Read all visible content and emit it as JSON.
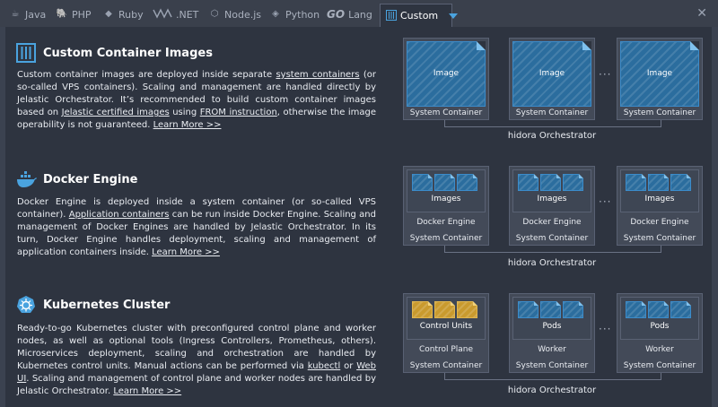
{
  "tabs": [
    {
      "label": "Java",
      "icon": "java-icon"
    },
    {
      "label": "PHP",
      "icon": "php-icon"
    },
    {
      "label": "Ruby",
      "icon": "ruby-icon"
    },
    {
      "label": ".NET",
      "icon": "dotnet-icon"
    },
    {
      "label": "Node.js",
      "icon": "nodejs-icon"
    },
    {
      "label": "Python",
      "icon": "python-icon"
    },
    {
      "label": "Lang",
      "logo_text": "GO",
      "icon": "go-icon"
    },
    {
      "label": "Custom",
      "icon": "custom-icon",
      "active": true
    }
  ],
  "colors": {
    "accent": "#4aa3df",
    "tile_blue": "#2b6d9e",
    "tile_gold": "#c99a2e",
    "panel_bg": "#2e3440"
  },
  "sections": {
    "custom": {
      "title": "Custom Container Images",
      "desc": {
        "p1": "Custom container images are deployed inside separate ",
        "link1": "system containers",
        "p2": " (or so-called VPS containers). Scaling and management are handled directly by Jelastic Orchestrator. It’s recommended to build custom container images based on ",
        "link2": "Jelastic certified images",
        "p3": " using ",
        "link3": "FROM instruction",
        "p4": ", otherwise the image operability is not guaranteed. ",
        "learn_more": "Learn More >>"
      },
      "diagram": {
        "image_label": "Image",
        "container_label": "System Container",
        "dots": "···",
        "orchestrator": "hidora Orchestrator"
      }
    },
    "docker": {
      "title": "Docker Engine",
      "desc": {
        "p1": "Docker Engine is deployed inside a system container (or so-called VPS container). ",
        "link1": "Application containers",
        "p2": " can be run inside Docker Engine. Scaling and management of Docker Engines are handled by Jelastic Orchestrator. In its turn, Docker Engine handles deployment, scaling and management of application containers inside. ",
        "learn_more": "Learn More >>"
      },
      "diagram": {
        "images_label": "Images",
        "engine_label": "Docker Engine",
        "container_label": "System Container",
        "dots": "···",
        "orchestrator": "hidora Orchestrator"
      }
    },
    "kubernetes": {
      "title": "Kubernetes Cluster",
      "desc": {
        "p1": "Ready-to-go Kubernetes cluster with preconfigured control plane and worker nodes, as well as optional tools (Ingress Controllers, Prometheus, others). Microservices deployment, scaling and orchestration are handled by Kubernetes control units. Manual actions can be performed via ",
        "link1": "kubectl",
        "p2": " or ",
        "link2": "Web UI",
        "p3": ". Scaling and management of control plane and worker nodes are handled by Jelastic Orchestrator. ",
        "learn_more": "Learn More >>"
      },
      "diagram": {
        "control_units_label": "Control Units",
        "control_plane_label": "Control Plane",
        "pods_label": "Pods",
        "worker_label": "Worker",
        "container_label": "System Container",
        "dots": "···",
        "orchestrator": "hidora Orchestrator"
      }
    }
  }
}
